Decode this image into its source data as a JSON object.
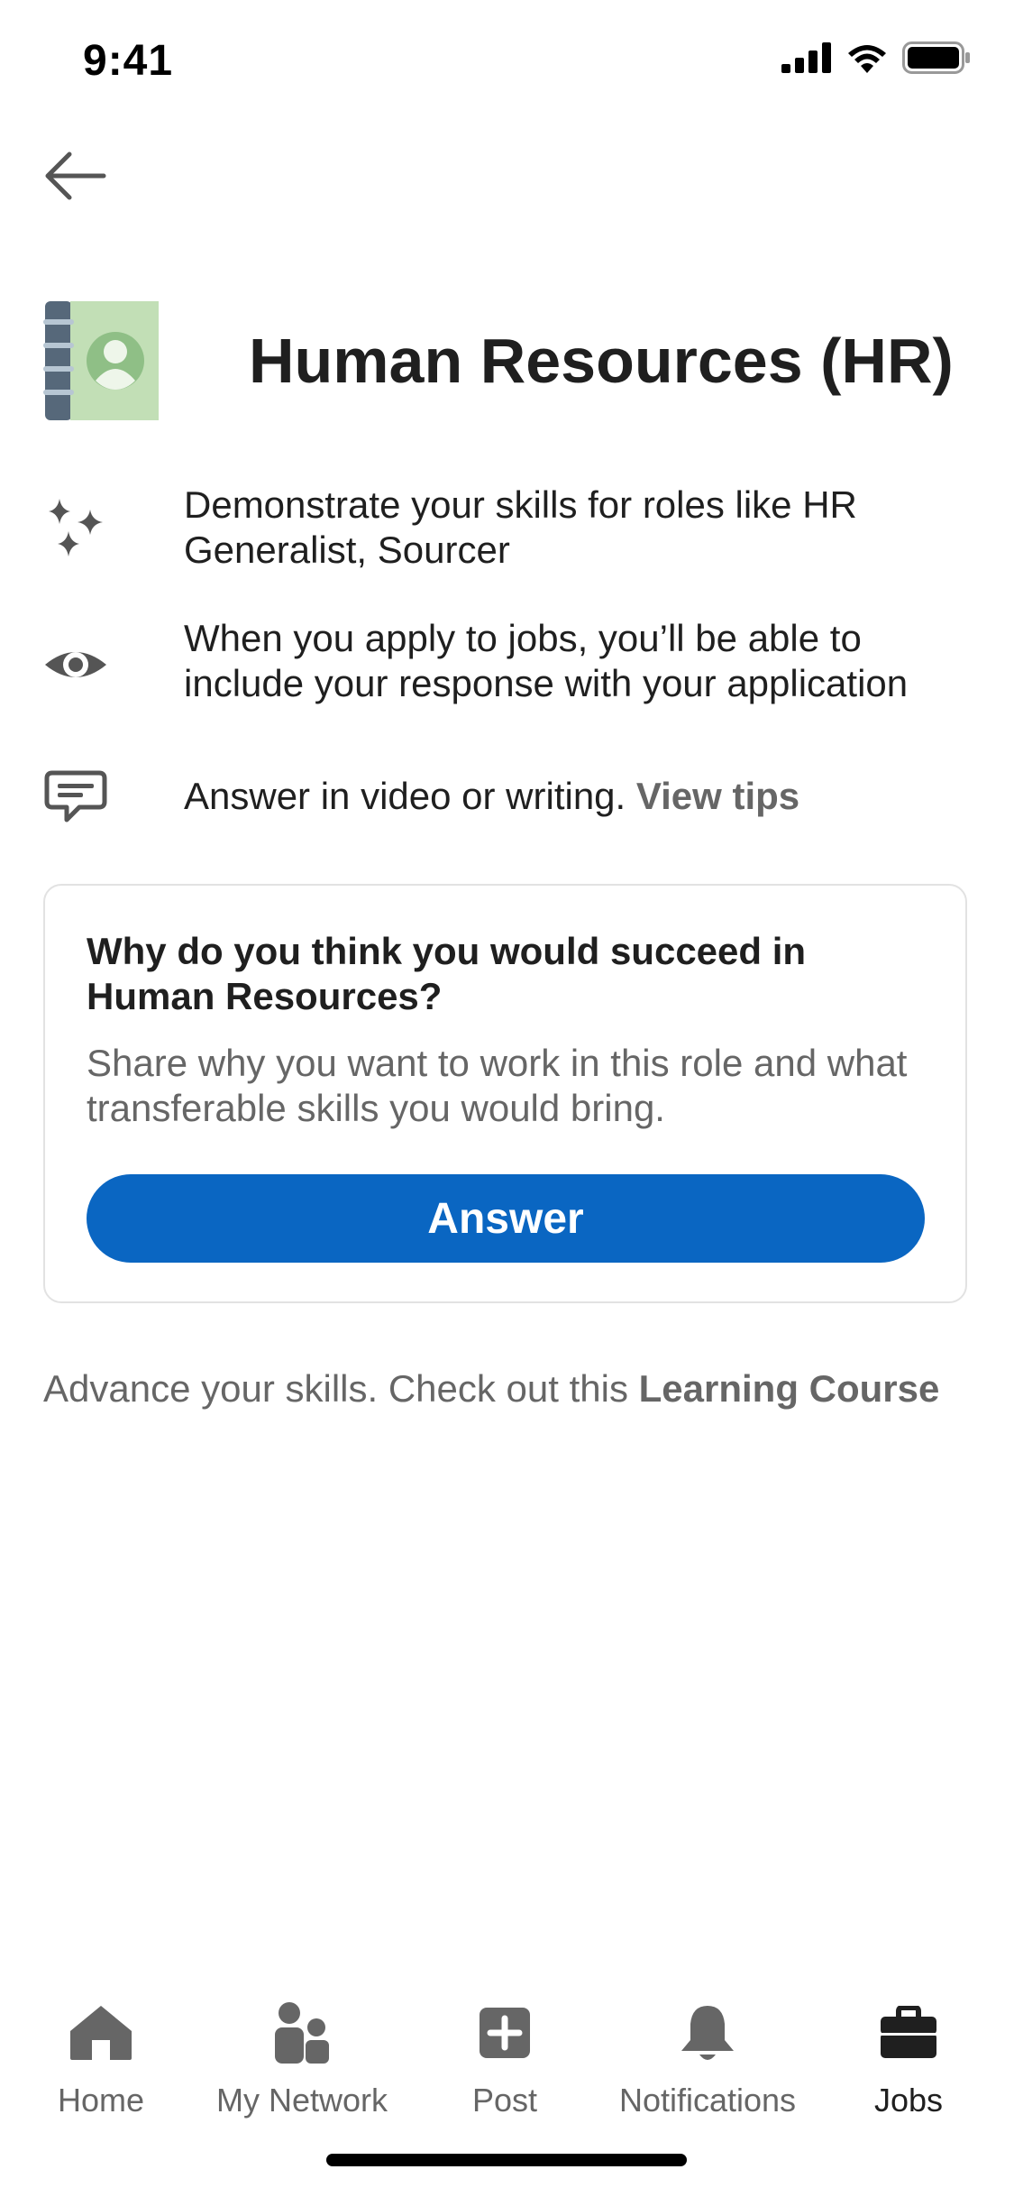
{
  "status_bar": {
    "time": "9:41",
    "icons": [
      "cellular-signal-icon",
      "wifi-icon",
      "battery-icon"
    ]
  },
  "header": {
    "back_icon": "arrow-left-icon",
    "title": "Human Resources (HR)",
    "logo_icon": "address-book-icon"
  },
  "info_rows": [
    {
      "icon": "sparkle-icon",
      "text": "Demonstrate your skills for roles like HR Generalist, Sourcer"
    },
    {
      "icon": "eye-icon",
      "text": "When you apply to jobs, you’ll be able to include your response with your application"
    },
    {
      "icon": "chat-bubble-icon",
      "text": "Answer in video or writing.",
      "link": "View tips"
    }
  ],
  "question_card": {
    "title": "Why do you think you would succeed in Human Resources?",
    "description": "Share why you want to work in this role and what transferable skills you would bring.",
    "button_label": "Answer"
  },
  "advance": {
    "text": "Advance your skills. Check out this",
    "link": "Learning Course"
  },
  "bottom_nav": {
    "items": [
      {
        "label": "Home",
        "icon": "home-icon",
        "active": false
      },
      {
        "label": "My Network",
        "icon": "people-icon",
        "active": false
      },
      {
        "label": "Post",
        "icon": "plus-square-icon",
        "active": false
      },
      {
        "label": "Notifications",
        "icon": "bell-icon",
        "active": false
      },
      {
        "label": "Jobs",
        "icon": "briefcase-icon",
        "active": true
      }
    ]
  },
  "colors": {
    "primary": "#0a66c2",
    "text": "#1f1f1f",
    "muted": "#666666",
    "logo_green": "#c2dfb6",
    "logo_spine": "#56687a"
  }
}
